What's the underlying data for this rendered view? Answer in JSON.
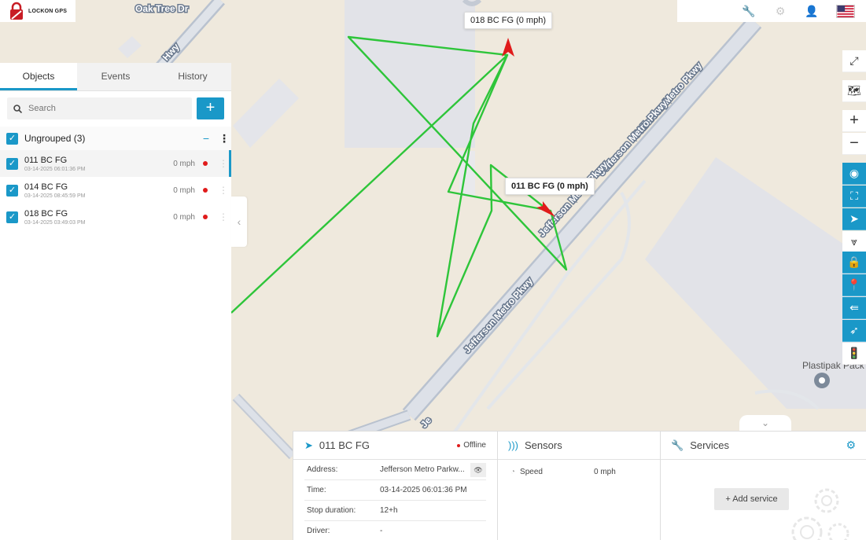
{
  "app": {
    "logo_text": "LOCKON GPS"
  },
  "map": {
    "streets": [
      "Oak Tree Dr",
      "Hwy",
      "Jefferson Metro Pkwy",
      "Jefferson Metro Pkwy",
      "Jefferson Metro Pkwy",
      "Jefferson Metro Pkwy",
      "Je"
    ],
    "poi": "Plastipak Pack",
    "vehicle_labels": [
      {
        "text": "018 BC FG (0 mph)"
      },
      {
        "text": "011 BC FG (0 mph)"
      }
    ],
    "track_color": "#2ec53a",
    "accent_color": "#1a98c8"
  },
  "sidebar": {
    "tabs": [
      {
        "label": "Objects",
        "active": true
      },
      {
        "label": "Events",
        "active": false
      },
      {
        "label": "History",
        "active": false
      }
    ],
    "search": {
      "placeholder": "Search",
      "add_label": "+"
    },
    "group": {
      "label": "Ungrouped (3)",
      "collapse": "−"
    },
    "objects": [
      {
        "name": "011 BC FG",
        "time": "03-14-2025 06:01:36 PM",
        "speed": "0 mph",
        "status_color": "#e01b1b"
      },
      {
        "name": "014 BC FG",
        "time": "03-14-2025 08:45:59 PM",
        "speed": "0 mph",
        "status_color": "#e01b1b"
      },
      {
        "name": "018 BC FG",
        "time": "03-14-2025 03:49:03 PM",
        "speed": "0 mph",
        "status_color": "#e01b1b"
      }
    ]
  },
  "details": {
    "object": {
      "title": "011 BC FG",
      "status": "Offline",
      "rows": [
        {
          "key": "Address:",
          "value": "Jefferson Metro Parkw..."
        },
        {
          "key": "Time:",
          "value": "03-14-2025 06:01:36 PM"
        },
        {
          "key": "Stop duration:",
          "value": "12+h"
        },
        {
          "key": "Driver:",
          "value": "-"
        }
      ]
    },
    "sensors": {
      "title": "Sensors",
      "rows": [
        {
          "key": "Speed",
          "value": "0 mph"
        }
      ]
    },
    "services": {
      "title": "Services",
      "add_label": "Add service"
    }
  }
}
